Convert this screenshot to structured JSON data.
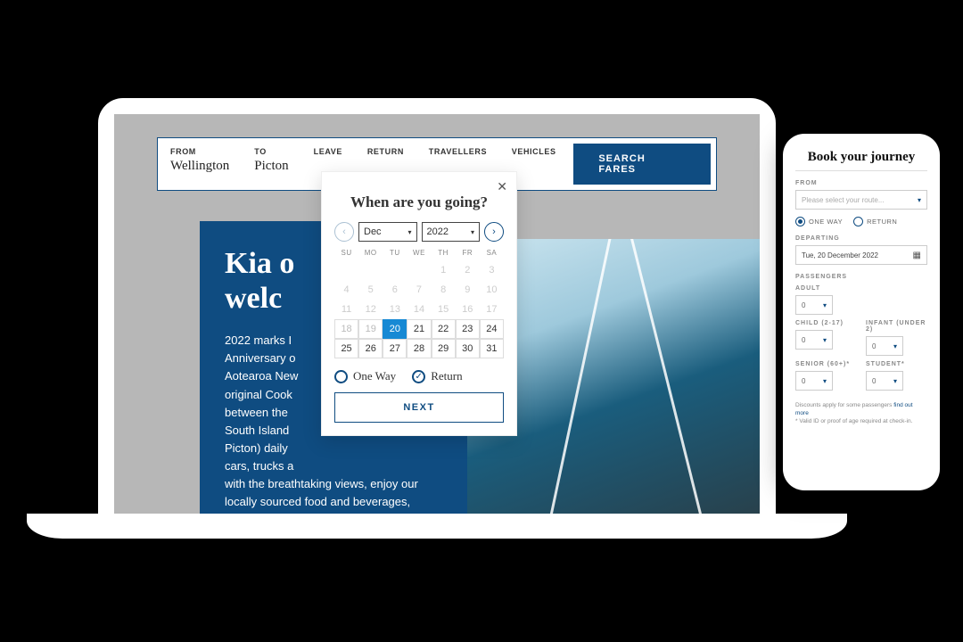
{
  "searchbar": {
    "from_label": "FROM",
    "from_value": "Wellington",
    "to_label": "TO",
    "to_value": "Picton",
    "leave_label": "LEAVE",
    "return_label": "RETURN",
    "travellers_label": "TRAVELLERS",
    "vehicles_label": "VEHICLES",
    "search_button": "SEARCH FARES"
  },
  "hero": {
    "title_line1": "Kia o",
    "title_line2": "welc",
    "body": "2022 marks I\nAnniversary o\nAotearoa New\noriginal Cook\nbetween the\nSouth Island\nPicton) daily\ncars, trucks a\nwith the breathtaking views, enjoy our locally sourced food and beverages, cinemas, free kids"
  },
  "popover": {
    "title": "When are you going?",
    "month": "Dec",
    "year": "2022",
    "dow": [
      "SU",
      "MO",
      "TU",
      "WE",
      "TH",
      "FR",
      "SA"
    ],
    "weeks": [
      [
        "",
        "",
        "",
        "",
        "1",
        "2",
        "3"
      ],
      [
        "4",
        "5",
        "6",
        "7",
        "8",
        "9",
        "10"
      ],
      [
        "11",
        "12",
        "13",
        "14",
        "15",
        "16",
        "17"
      ],
      [
        "18",
        "19",
        "20",
        "21",
        "22",
        "23",
        "24"
      ],
      [
        "25",
        "26",
        "27",
        "28",
        "29",
        "30",
        "31"
      ]
    ],
    "selected_day": "20",
    "oneway_label": "One Way",
    "return_label": "Return",
    "trip_selected": "return",
    "next_button": "NEXT"
  },
  "phone": {
    "title": "Book your journey",
    "from_label": "FROM",
    "route_placeholder": "Please select your route...",
    "oneway_label": "ONE WAY",
    "return_label": "RETURN",
    "trip_selected": "oneway",
    "departing_label": "DEPARTING",
    "departing_value": "Tue, 20 December 2022",
    "passengers_label": "PASSENGERS",
    "adult_label": "ADULT",
    "child_label": "CHILD (2-17)",
    "infant_label": "INFANT (UNDER 2)",
    "senior_label": "SENIOR (60+)*",
    "student_label": "STUDENT*",
    "count_default": "0",
    "footer_text": "Discounts apply for some passengers ",
    "footer_link": "find out more",
    "footer_text2": "* Valid ID or proof of age required at check-in."
  }
}
